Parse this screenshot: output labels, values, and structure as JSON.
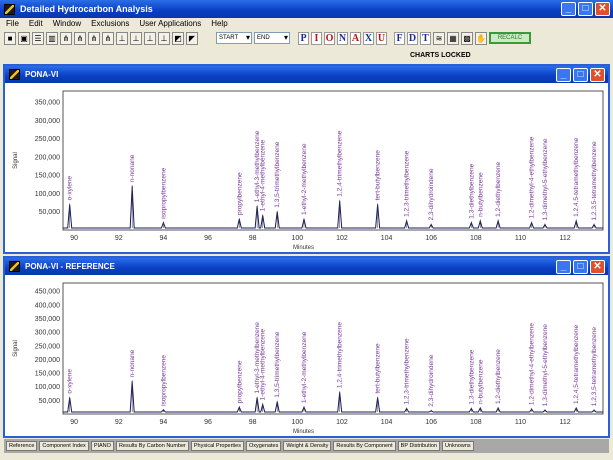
{
  "app": {
    "title": "Detailed Hydrocarbon Analysis"
  },
  "menu": [
    "File",
    "Edit",
    "Window",
    "Exclusions",
    "User Applications",
    "Help"
  ],
  "toolbar": {
    "start": "START",
    "end": "END",
    "letters": [
      "P",
      "I",
      "O",
      "N",
      "A",
      "X",
      "U"
    ],
    "letters2": [
      "F",
      "D",
      "T"
    ],
    "recalc": "RECALC",
    "status": "CHARTS LOCKED"
  },
  "windows": [
    {
      "title": "PONA-VI"
    },
    {
      "title": "PONA-VI - REFERENCE"
    }
  ],
  "tabs": [
    "Reference",
    "Component Index",
    "PIANO",
    "Results By Carbon Number",
    "Physical Properties",
    "Oxygenates",
    "Weight & Density",
    "Results By Component",
    "BP Distribution",
    "Unknowns"
  ],
  "colors": {
    "titlebar": "#0a3fc4",
    "peak_label": "#7a3a9a",
    "trace": "#1a1a60"
  },
  "chart_data": [
    {
      "type": "line",
      "xlabel": "Minutes",
      "ylabel": "Signal",
      "xlim": [
        89.5,
        113.7
      ],
      "ylim": [
        0,
        380000
      ],
      "xticks": [
        90,
        92,
        94,
        96,
        98,
        100,
        102,
        104,
        106,
        108,
        110,
        112
      ],
      "yticks": [
        50000,
        100000,
        150000,
        200000,
        250000,
        300000,
        350000
      ],
      "peaks": [
        [
          89.8,
          70000,
          "o-xylene"
        ],
        [
          92.6,
          120000,
          "n-nonane"
        ],
        [
          94.0,
          20000,
          "isopropylbenzene"
        ],
        [
          97.4,
          30000,
          "propylbenzene"
        ],
        [
          98.2,
          65000,
          "1-ethyl-3-methylbenzene"
        ],
        [
          98.45,
          40000,
          "1-ethyl-4-methylbenzene"
        ],
        [
          99.1,
          50000,
          "1,3,5-trimethylbenzene"
        ],
        [
          100.3,
          30000,
          "1-ethyl-2-methylbenzene"
        ],
        [
          101.9,
          80000,
          "1,2,4-trimethylbenzene"
        ],
        [
          103.6,
          70000,
          "tert-butylbenzene"
        ],
        [
          104.9,
          25000,
          "1,2,3-trimethylbenzene"
        ],
        [
          106.0,
          15000,
          "2,3-dihydroindene"
        ],
        [
          107.8,
          20000,
          "1,3-diethylbenzene"
        ],
        [
          108.2,
          25000,
          "n-butylbenzene"
        ],
        [
          109.0,
          25000,
          "1,2-diethylbenzene"
        ],
        [
          110.5,
          20000,
          "1,2-dimethyl-4-ethylbenzene"
        ],
        [
          111.1,
          15000,
          "1,3-dimethyl-5-ethylbenzene"
        ],
        [
          112.5,
          25000,
          "1,2,4,5-tetramethylbenzene"
        ],
        [
          113.3,
          15000,
          "1,2,3,5-tetramethylbenzene"
        ]
      ]
    },
    {
      "type": "line",
      "xlabel": "Minutes",
      "ylabel": "Signal",
      "xlim": [
        89.5,
        113.7
      ],
      "ylim": [
        0,
        480000
      ],
      "xticks": [
        90,
        92,
        94,
        96,
        98,
        100,
        102,
        104,
        106,
        108,
        110,
        112
      ],
      "yticks": [
        50000,
        100000,
        150000,
        200000,
        250000,
        300000,
        350000,
        400000,
        450000
      ],
      "peaks": [
        [
          89.8,
          60000,
          "o-xylene"
        ],
        [
          92.6,
          120000,
          "n-nonane"
        ],
        [
          94.0,
          15000,
          "isopropylbenzene"
        ],
        [
          97.4,
          25000,
          "propylbenzene"
        ],
        [
          98.2,
          60000,
          "1-ethyl-3-methylbenzene"
        ],
        [
          98.45,
          35000,
          "1-ethyl-4-methylbenzene"
        ],
        [
          99.1,
          45000,
          "1,3,5-trimethylbenzene"
        ],
        [
          100.3,
          25000,
          "1-ethyl-2-methylbenzene"
        ],
        [
          101.9,
          80000,
          "1,2,4-trimethylbenzene"
        ],
        [
          103.6,
          60000,
          "tert-butylbenzene"
        ],
        [
          104.9,
          20000,
          "1,2,3-trimethylbenzene"
        ],
        [
          106.0,
          12000,
          "2,3-dihydroindene"
        ],
        [
          107.8,
          20000,
          "1,3-diethylbenzene"
        ],
        [
          108.2,
          22000,
          "n-butylbenzene"
        ],
        [
          109.0,
          22000,
          "1,2-diethylbenzene"
        ],
        [
          110.5,
          18000,
          "1,2-dimethyl-4-ethylbenzene"
        ],
        [
          111.1,
          14000,
          "1,3-dimethyl-5-ethylbenzene"
        ],
        [
          112.5,
          22000,
          "1,2,4,5-tetramethylbenzene"
        ],
        [
          113.3,
          14000,
          "1,2,3,5-tetramethylbenzene"
        ]
      ]
    }
  ]
}
